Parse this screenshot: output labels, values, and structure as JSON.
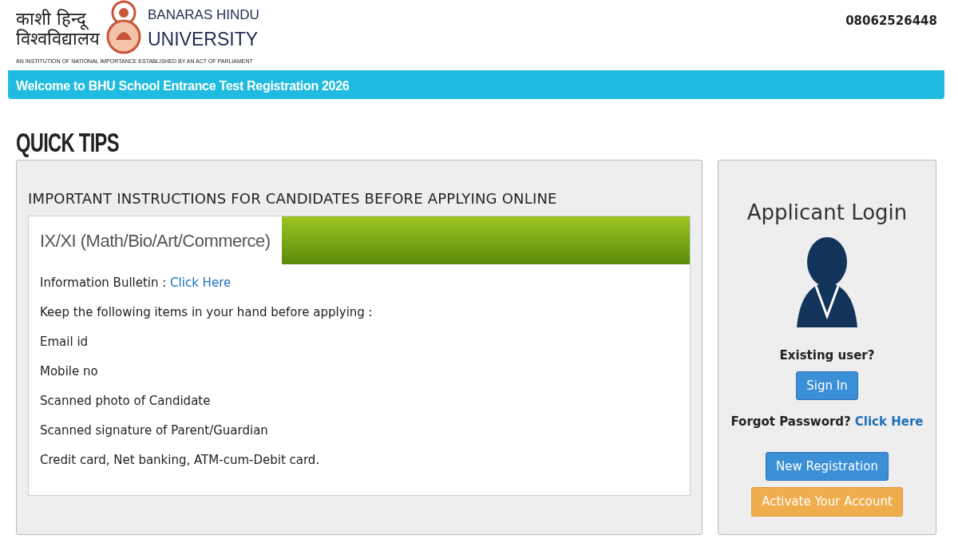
{
  "header": {
    "name_hindi_line1": "काशी हिन्दू",
    "name_hindi_line2": "विश्वविद्यालय",
    "name_english_line1": "BANARAS HINDU",
    "name_english_line2": "UNIVERSITY",
    "tagline": "AN INSTITUTION OF NATIONAL IMPORTANCE ESTABLISHED BY AN ACT OF PARLIAMENT",
    "phone": "08062526448"
  },
  "welcome_bar": "Welcome to BHU School Entrance Test Registration 2026",
  "page_title": "QUICK TIPS",
  "instructions": {
    "heading": "IMPORTANT INSTRUCTIONS FOR CANDIDATES BEFORE APPLYING ONLINE",
    "tabs": [
      {
        "label": "IX/XI (Math/Bio/Art/Commerce)",
        "selected": true
      }
    ],
    "items": [
      {
        "kind": "link",
        "text": "Information Bulletin : ",
        "link": "Click Here"
      },
      {
        "kind": "text",
        "text": "Keep the following items in your hand before applying :"
      },
      {
        "kind": "text",
        "text": "Email id"
      },
      {
        "kind": "text",
        "text": "Mobile no"
      },
      {
        "kind": "text",
        "text": "Scanned photo of Candidate"
      },
      {
        "kind": "text",
        "text": "Scanned signature of Parent/Guardian"
      },
      {
        "kind": "text",
        "text": "Credit card, Net banking, ATM-cum-Debit card."
      }
    ]
  },
  "login": {
    "title": "Applicant Login",
    "existing_user": "Existing user?",
    "sign_in": "Sign In",
    "forgot_text": "Forgot Password?",
    "forgot_link": "Click Here",
    "new_registration": "New Registration",
    "activate": "Activate Your Account"
  }
}
